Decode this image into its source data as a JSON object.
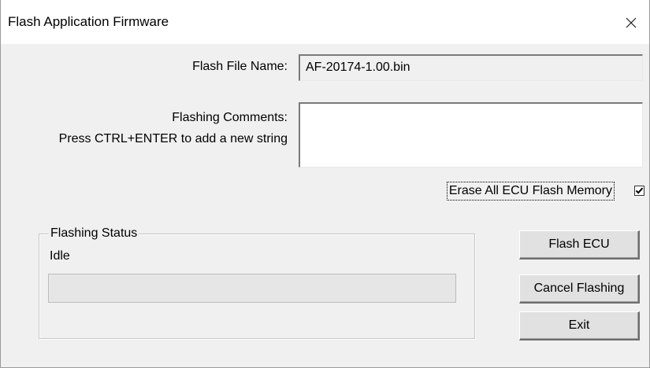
{
  "window": {
    "title": "Flash Application Firmware",
    "close_icon": "close-icon"
  },
  "form": {
    "flash_file_label": "Flash File Name:",
    "flash_file_value": "AF-20174-1.00.bin",
    "comments_label": "Flashing Comments:",
    "comments_hint": "Press CTRL+ENTER to add a new string",
    "comments_value": "",
    "erase_label": "Erase All ECU Flash Memory",
    "erase_checked": true
  },
  "status_group": {
    "legend": "Flashing Status",
    "status_text": "Idle",
    "progress_fraction": 0
  },
  "buttons": {
    "flash": "Flash ECU",
    "cancel": "Cancel Flashing",
    "exit": "Exit"
  }
}
